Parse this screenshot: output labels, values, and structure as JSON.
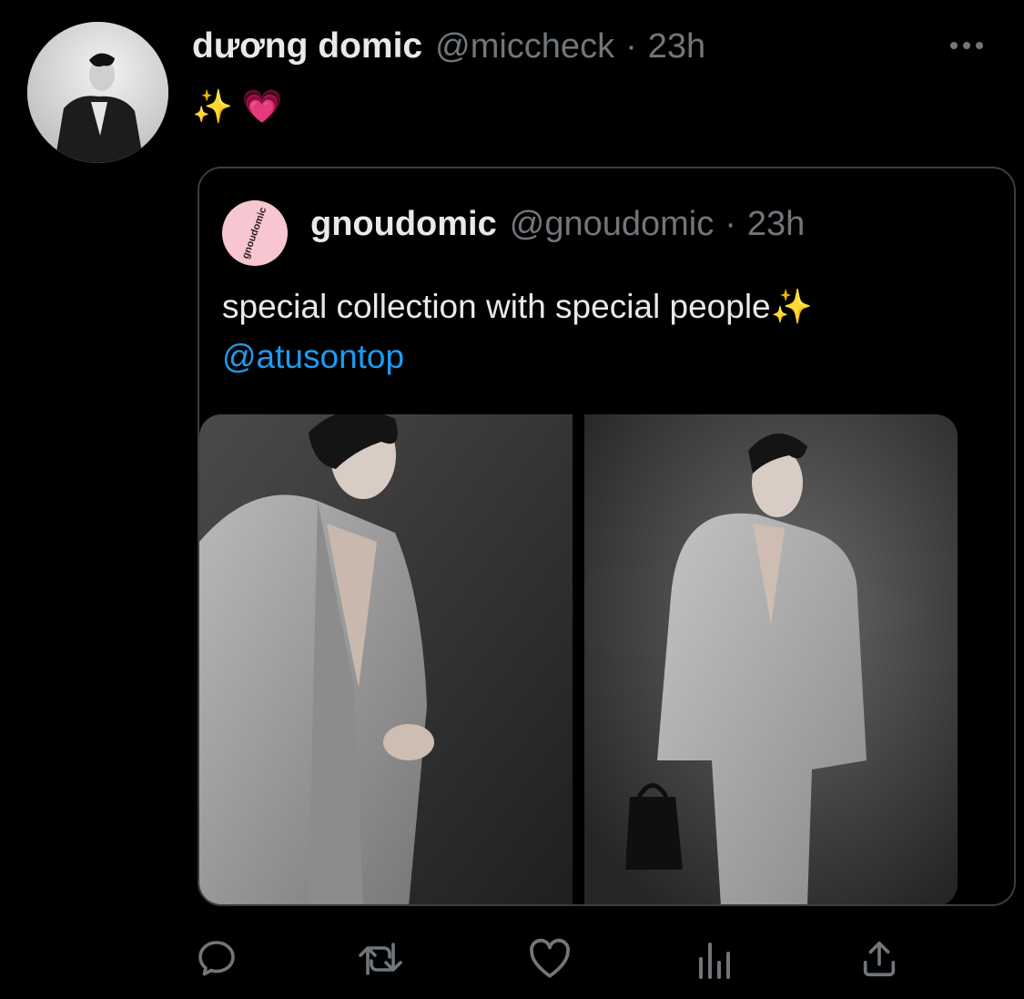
{
  "tweet": {
    "author_name": "dương domic",
    "author_handle": "@miccheck",
    "separator": "·",
    "time": "23h",
    "text": "✨ 💗"
  },
  "quoted_tweet": {
    "avatar_text": "gnoudomic",
    "author_name": "gnoudomic",
    "author_handle": "@gnoudomic",
    "separator": "·",
    "time": "23h",
    "text": "special collection with special people✨",
    "mention": "@atusontop"
  },
  "icons": {
    "more": "more-horizontal-icon",
    "reply": "reply-icon",
    "retweet": "retweet-icon",
    "like": "heart-icon",
    "analytics": "analytics-icon",
    "share": "share-icon"
  },
  "colors": {
    "background": "#000000",
    "text": "#e7e9ea",
    "secondary": "#71767b",
    "link": "#1d9bf0",
    "border": "#3a3d41"
  }
}
